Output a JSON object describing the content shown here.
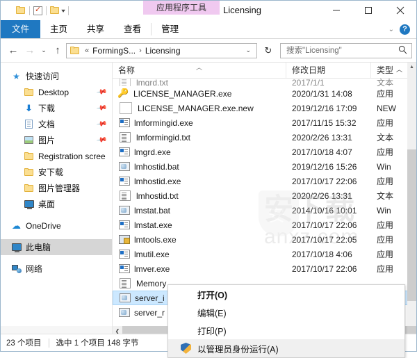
{
  "window": {
    "title": "Licensing",
    "contextual_tab_group": "应用程序工具",
    "minimize": "—",
    "maximize": "▢",
    "close": "✕"
  },
  "quick_access": {
    "items": [
      {
        "name": "folder-icon",
        "label": ""
      },
      {
        "name": "properties-icon",
        "label": ""
      },
      {
        "name": "new-folder-icon",
        "label": ""
      },
      {
        "name": "customize-dropdown",
        "label": "▾"
      }
    ]
  },
  "ribbon": {
    "tabs": [
      {
        "label": "文件",
        "active_style": "file"
      },
      {
        "label": "主页"
      },
      {
        "label": "共享"
      },
      {
        "label": "查看"
      },
      {
        "label": "管理",
        "contextual": true
      }
    ],
    "collapse_icon": "⌄",
    "help_icon": "?"
  },
  "addressbar": {
    "back": "←",
    "forward": "→",
    "recent": "⌄",
    "up": "↑",
    "overflow": "«",
    "crumbs": [
      "FormingS...",
      "Licensing"
    ],
    "crumb_sep": "›",
    "dropdown": "⌄",
    "refresh": "↻"
  },
  "search": {
    "placeholder": "搜索\"Licensing\"",
    "value": "",
    "icon": "search-icon"
  },
  "sidebar": {
    "items": [
      {
        "label": "快速访问",
        "icon": "star-icon",
        "root": true,
        "pinned": false
      },
      {
        "label": "Desktop",
        "icon": "folder-icon",
        "pinned": true
      },
      {
        "label": "下载",
        "icon": "download-icon",
        "pinned": true
      },
      {
        "label": "文档",
        "icon": "documents-icon",
        "pinned": true
      },
      {
        "label": "图片",
        "icon": "pictures-icon",
        "pinned": true
      },
      {
        "label": "Registration scree",
        "icon": "folder-icon",
        "pinned": false
      },
      {
        "label": "安下载",
        "icon": "folder-icon",
        "pinned": false
      },
      {
        "label": "图片管理器",
        "icon": "folder-icon",
        "pinned": false
      },
      {
        "label": "桌面",
        "icon": "desktop-icon",
        "pinned": false
      },
      {
        "label": "OneDrive",
        "icon": "cloud-icon",
        "root": true,
        "pinned": false
      },
      {
        "label": "此电脑",
        "icon": "computer-icon",
        "root": true,
        "pinned": false,
        "selected": true
      },
      {
        "label": "网络",
        "icon": "network-icon",
        "root": true,
        "pinned": false
      }
    ]
  },
  "filelist": {
    "columns": [
      {
        "key": "name",
        "label": "名称",
        "sorted": true
      },
      {
        "key": "date",
        "label": "修改日期"
      },
      {
        "key": "type",
        "label": "类型"
      }
    ],
    "rows": [
      {
        "name": "LICENSE_MANAGER.exe",
        "date": "2020/1/31 14:08",
        "type": "应用",
        "icon": "key-icon"
      },
      {
        "name": "LICENSE_MANAGER.exe.new",
        "date": "2019/12/16 17:09",
        "type": "NEW",
        "icon": "blank-file-icon"
      },
      {
        "name": "lmformingid.exe",
        "date": "2017/11/15 15:32",
        "type": "应用",
        "icon": "application-icon"
      },
      {
        "name": "lmformingid.txt",
        "date": "2020/2/26 13:31",
        "type": "文本",
        "icon": "text-file-icon"
      },
      {
        "name": "lmgrd.exe",
        "date": "2017/10/18 4:07",
        "type": "应用",
        "icon": "application-icon"
      },
      {
        "name": "lmhostid.bat",
        "date": "2019/12/16 15:26",
        "type": "Win",
        "icon": "batch-file-icon"
      },
      {
        "name": "lmhostid.exe",
        "date": "2017/10/17 22:06",
        "type": "应用",
        "icon": "application-icon"
      },
      {
        "name": "lmhostid.txt",
        "date": "2020/2/26 13:31",
        "type": "文本",
        "icon": "text-file-icon"
      },
      {
        "name": "lmstat.bat",
        "date": "2014/10/16 10:01",
        "type": "Win",
        "icon": "batch-file-icon"
      },
      {
        "name": "lmstat.exe",
        "date": "2017/10/17 22:06",
        "type": "应用",
        "icon": "application-icon"
      },
      {
        "name": "lmtools.exe",
        "date": "2017/10/17 22:05",
        "type": "应用",
        "icon": "tools-icon"
      },
      {
        "name": "lmutil.exe",
        "date": "2017/10/18 4:06",
        "type": "应用",
        "icon": "application-icon"
      },
      {
        "name": "lmver.exe",
        "date": "2017/10/17 22:06",
        "type": "应用",
        "icon": "application-icon"
      },
      {
        "name": "Memory",
        "date": "",
        "type": "",
        "icon": "text-file-icon"
      },
      {
        "name": "server_i",
        "date": "",
        "type": "",
        "icon": "batch-file-icon",
        "selected": true
      },
      {
        "name": "server_r",
        "date": "",
        "type": "",
        "icon": "batch-file-icon"
      }
    ]
  },
  "context_menu": {
    "items": [
      {
        "label": "打开(O)",
        "bold": true
      },
      {
        "label": "编辑(E)",
        "bold": false
      },
      {
        "label": "打印(P)",
        "bold": false
      },
      {
        "label": "以管理员身份运行(A)",
        "bold": false,
        "icon": "shield-icon",
        "highlighted": true
      }
    ]
  },
  "statusbar": {
    "item_count": "23 个项目",
    "selection": "选中 1 个项目  148 字节"
  },
  "watermark": {
    "primary": "安下载",
    "secondary": "anxz.com"
  }
}
